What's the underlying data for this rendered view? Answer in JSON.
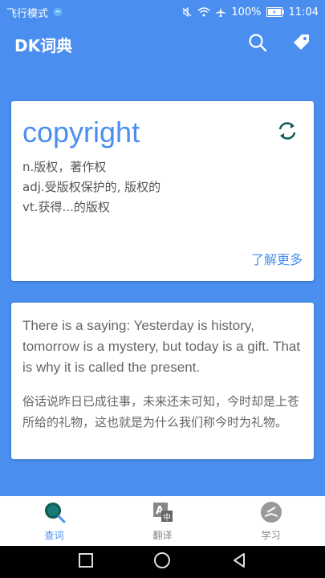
{
  "status_bar": {
    "left_text": "飞行模式",
    "battery": "100%",
    "time": "11:04"
  },
  "app_bar": {
    "title": "DK词典",
    "actions": [
      "search-icon",
      "tag-icon"
    ]
  },
  "word_card": {
    "word": "copyright",
    "definitions": [
      "n.版权，著作权",
      "adj.受版权保护的, 版权的",
      "vt.获得...的版权"
    ],
    "more_link": "了解更多"
  },
  "quote_card": {
    "english": "There is a saying: Yesterday is history, tomorrow is a mystery, but today is a gift. That is why it is called the present.",
    "chinese": "俗话说昨日已成往事，未来还未可知，今时却是上苍所给的礼物，这也就是为什么我们称今时为礼物。"
  },
  "tabs": [
    {
      "label": "查词",
      "icon": "search-tab-icon",
      "active": true
    },
    {
      "label": "翻译",
      "icon": "translate-tab-icon",
      "active": false
    },
    {
      "label": "学习",
      "icon": "study-tab-icon",
      "active": false
    }
  ],
  "colors": {
    "primary": "#4a8ff0",
    "refresh": "#0f5b57"
  }
}
